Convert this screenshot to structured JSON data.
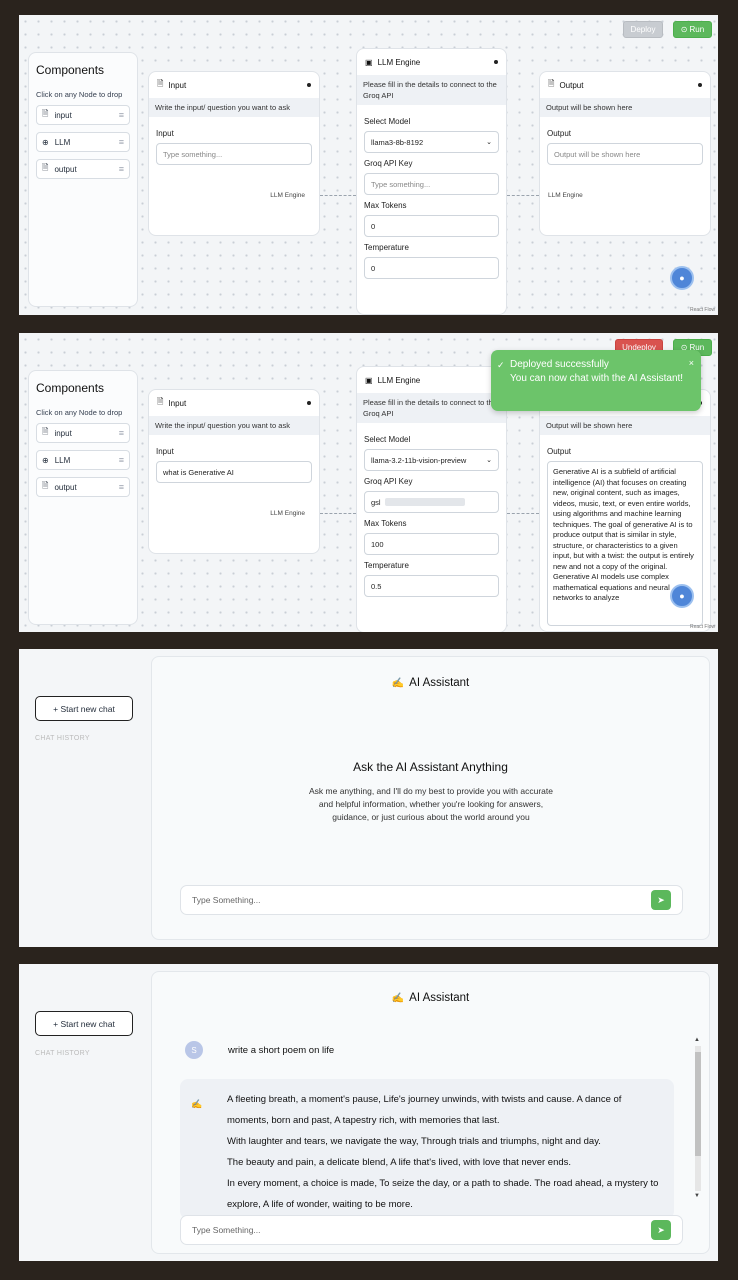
{
  "flow": {
    "deploy_label": "Deploy",
    "undeploy_label": "Undeploy",
    "run_label": "Run",
    "components_title": "Components",
    "components_hint": "Click on any Node to drop",
    "components": [
      {
        "label": "input",
        "icon": "document-icon"
      },
      {
        "label": "LLM",
        "icon": "chip-icon"
      },
      {
        "label": "output",
        "icon": "document-icon"
      }
    ],
    "input_node": {
      "title": "Input",
      "description": "Write the input/ question you want to ask",
      "field_label": "Input",
      "placeholder": "Type something...",
      "port_label": "LLM Engine"
    },
    "llm_node": {
      "title": "LLM Engine",
      "description": "Please fill in the details to connect to the Groq API",
      "model_label": "Select Model",
      "api_key_label": "Groq API Key",
      "api_key_placeholder": "Type something...",
      "max_tokens_label": "Max Tokens",
      "temperature_label": "Temperature"
    },
    "output_node": {
      "title": "Output",
      "description": "Output will be shown here",
      "field_label": "Output",
      "placeholder": "Output will be shown here",
      "port_label": "LLM Engine"
    },
    "attribution": "React Flow"
  },
  "screen1": {
    "model": "llama3-8b-8192",
    "max_tokens": "0",
    "temperature": "0"
  },
  "screen2": {
    "input_value": "what is Generative AI",
    "model": "llama-3.2-11b-vision-preview",
    "api_key_value": "gsl",
    "max_tokens": "100",
    "temperature": "0.5",
    "toast_title": "Deployed successfully",
    "toast_body": "You can now chat with the AI Assistant!",
    "output_text": "Generative AI is a subfield of artificial intelligence (AI) that focuses on creating new, original content, such as images, videos, music, text, or even entire worlds, using algorithms and machine learning techniques. The goal of generative AI is to produce output that is similar in style, structure, or characteristics to a given input, but with a twist: the output is entirely new and not a copy of the original. Generative AI models use complex mathematical equations and neural networks to analyze"
  },
  "chat": {
    "new_chat_label": "+ Start new chat",
    "history_label": "CHAT HISTORY",
    "title": "AI Assistant",
    "welcome_title": "Ask the AI Assistant Anything",
    "welcome_body": "Ask me anything, and I'll do my best to provide you with accurate and helpful information, whether you're looking for answers, guidance, or just curious about the world around you",
    "input_placeholder": "Type Something...",
    "user_initial": "S",
    "user_message": "write a short poem on life",
    "bot_lines": [
      "A fleeting breath, a moment's pause, Life's journey unwinds, with twists and cause. A dance of moments, born and past, A tapestry rich, with memories that last.",
      "With laughter and tears, we navigate the way, Through trials and triumphs, night and day.",
      "The beauty and pain, a delicate blend, A life that's lived, with love that never ends.",
      "In every moment, a choice is made, To seize the day, or a path to shade. The road ahead, a mystery to explore, A life of wonder, waiting to be more."
    ]
  },
  "colors": {
    "run_green": "#5cb85c",
    "undeploy_red": "#d9534f",
    "toast_green": "#6cc46a",
    "fab_blue": "#4f86d8"
  }
}
